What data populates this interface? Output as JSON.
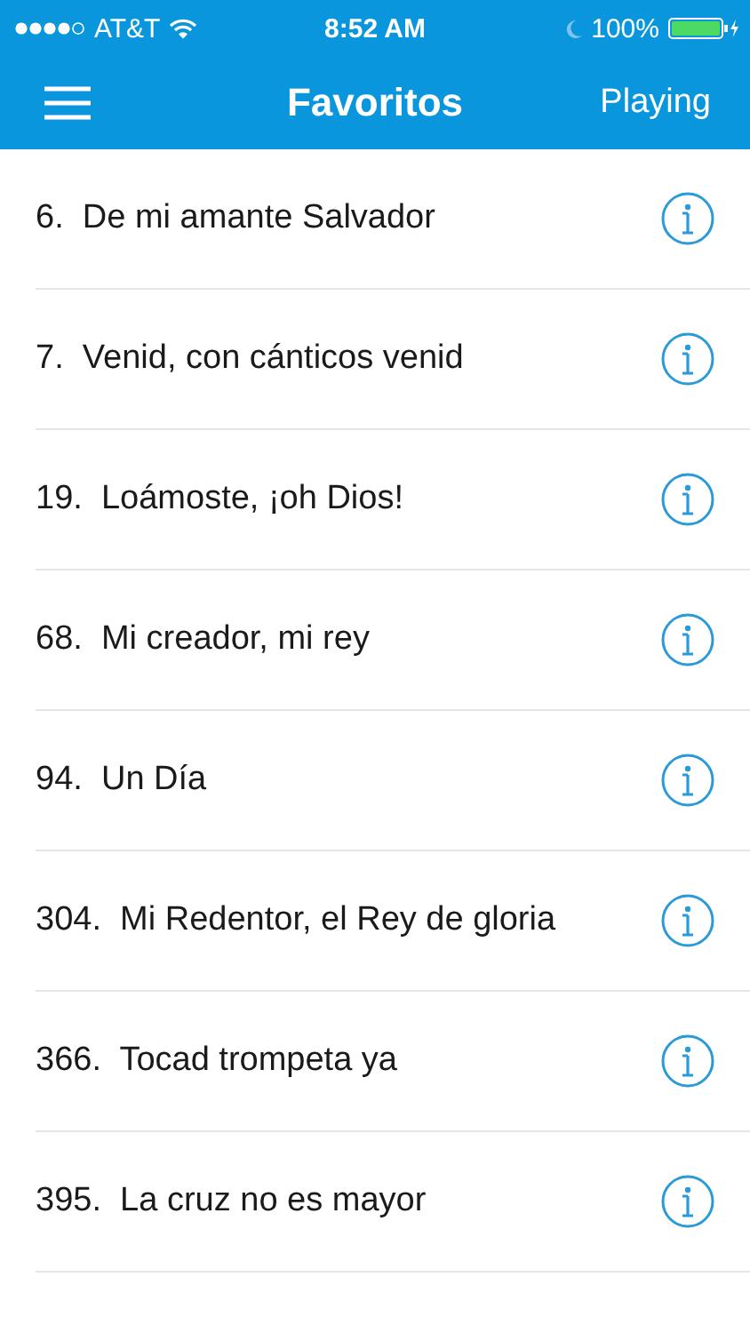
{
  "status_bar": {
    "carrier": "AT&T",
    "time": "8:52 AM",
    "battery": "100%"
  },
  "nav_bar": {
    "title": "Favoritos",
    "right_button": "Playing"
  },
  "songs": [
    {
      "number": "6.",
      "title": "De mi amante Salvador"
    },
    {
      "number": "7.",
      "title": "Venid, con cánticos venid"
    },
    {
      "number": "19.",
      "title": "Loámoste, ¡oh Dios!"
    },
    {
      "number": "68.",
      "title": "Mi creador, mi rey"
    },
    {
      "number": "94.",
      "title": "Un Día"
    },
    {
      "number": "304.",
      "title": "Mi Redentor, el Rey de gloria"
    },
    {
      "number": "366.",
      "title": "Tocad trompeta ya"
    },
    {
      "number": "395.",
      "title": "La cruz no es mayor"
    }
  ]
}
